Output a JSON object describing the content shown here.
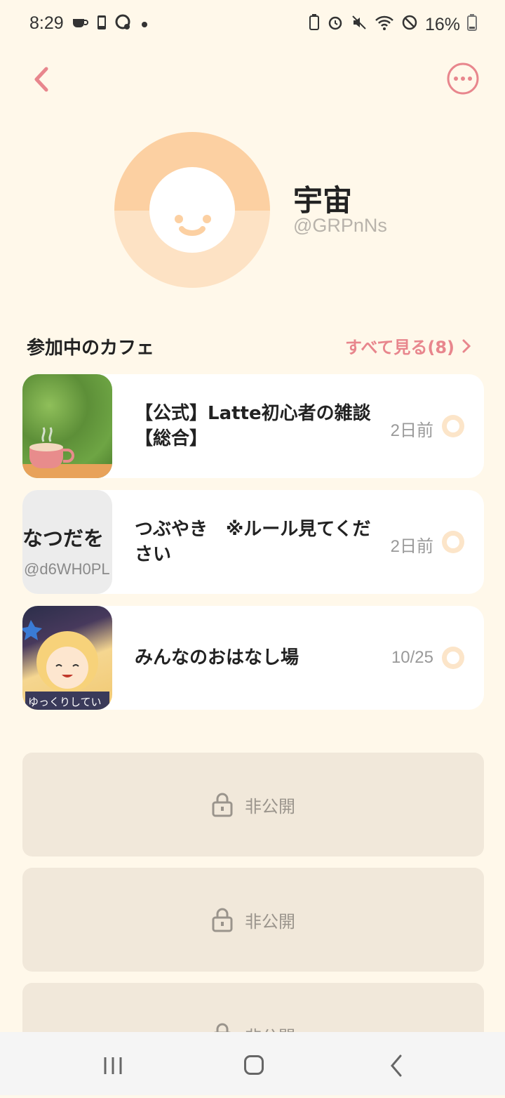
{
  "status_bar": {
    "time": "8:29",
    "battery_percent": "16%",
    "left_icons": [
      "cup-icon",
      "phone-icon",
      "chat-icon",
      "dot-icon"
    ],
    "right_icons": [
      "battery-saver-icon",
      "alarm-icon",
      "mute-icon",
      "wifi-icon",
      "dnd-icon",
      "battery-icon"
    ]
  },
  "header": {
    "back_icon": "chevron-left-icon",
    "more_icon": "more-icon",
    "accent_color": "#e8868d"
  },
  "profile": {
    "name": "宇宙",
    "handle": "@GRPnNs"
  },
  "cafes_section": {
    "title": "参加中のカフェ",
    "see_all": "すべて見る(8)"
  },
  "cafes": [
    {
      "name": "【公式】Latte初心者の雑談【総合】",
      "time": "2日前",
      "thumb": "coffee-cup-photo"
    },
    {
      "name": "つぶやき　※ルール見てください",
      "time": "2日前",
      "thumb": "text-thumb",
      "thumb_text": "なつだを",
      "thumb_subtext": "@d6WH0PL"
    },
    {
      "name": "みんなのおはなし場",
      "time": "10/25",
      "thumb": "anime-character-image",
      "thumb_caption": "ゆっくりしてい"
    }
  ],
  "private_cards": [
    {
      "label": "非公開"
    },
    {
      "label": "非公開"
    },
    {
      "label": "非公開"
    }
  ]
}
